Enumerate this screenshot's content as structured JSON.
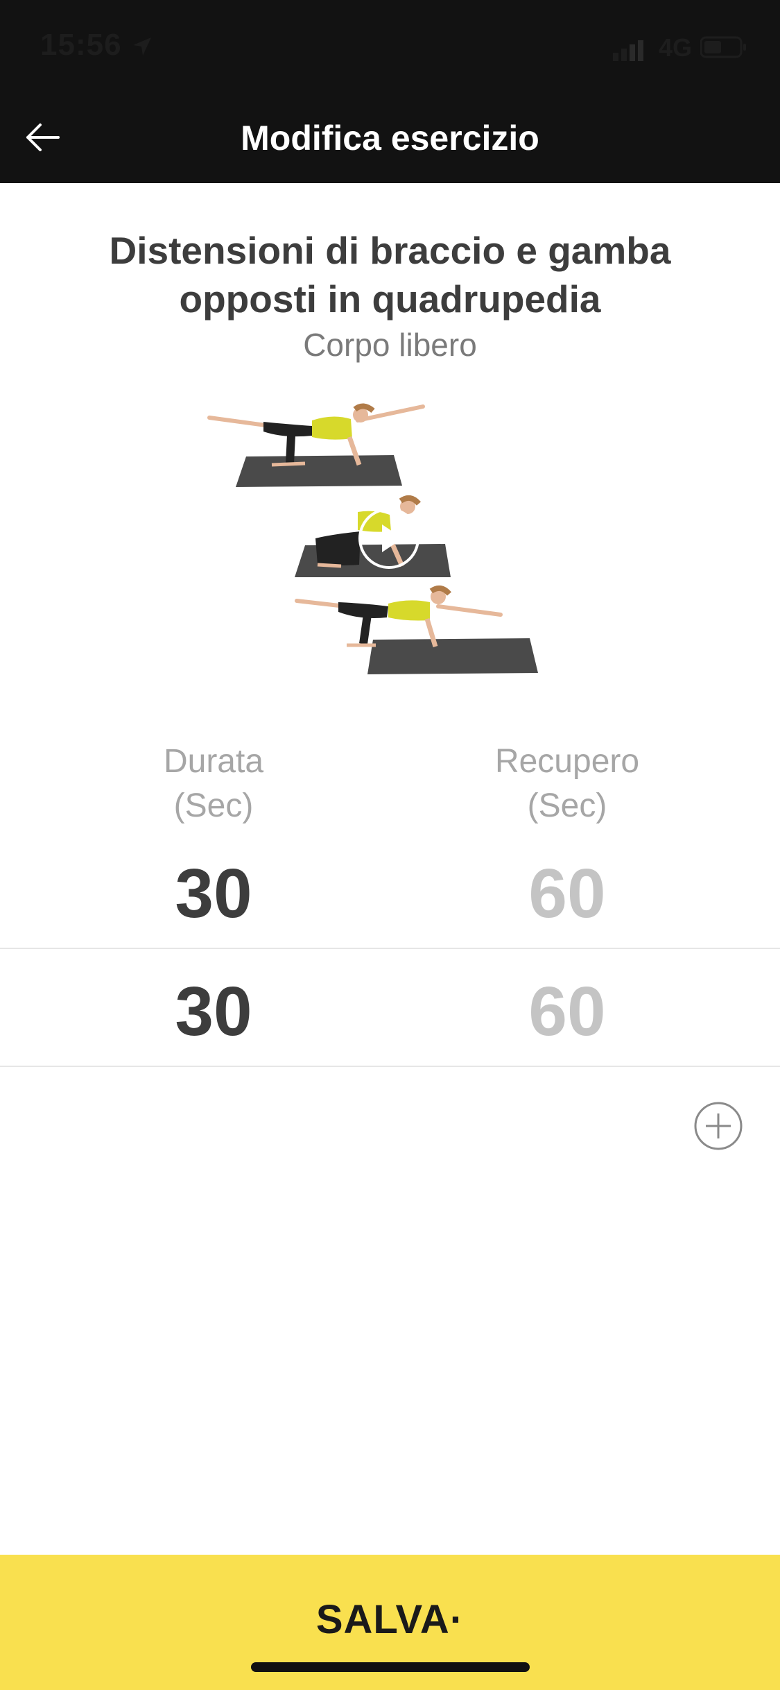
{
  "status_bar": {
    "time": "15:56",
    "network": "4G",
    "location_icon": "location-arrow-icon",
    "signal_icon": "cell-signal-icon",
    "battery_icon": "battery-icon"
  },
  "nav": {
    "title": "Modifica esercizio",
    "back_icon": "arrow-left-icon"
  },
  "exercise": {
    "title": "Distensioni di braccio e gamba opposti in quadrupedia",
    "category": "Corpo libero",
    "media_icon": "play-icon"
  },
  "table": {
    "headers": {
      "durata": "Durata\n(Sec)",
      "recupero": "Recupero\n(Sec)"
    },
    "rows": [
      {
        "durata": "30",
        "recupero": "60"
      },
      {
        "durata": "30",
        "recupero": "60"
      }
    ],
    "add_icon": "plus-circle-icon"
  },
  "footer": {
    "save_label": "SALVA·"
  },
  "colors": {
    "header": "#121212",
    "accent": "#f9e04f",
    "text": "#3d3d3d",
    "muted": "#c4c4c4"
  }
}
